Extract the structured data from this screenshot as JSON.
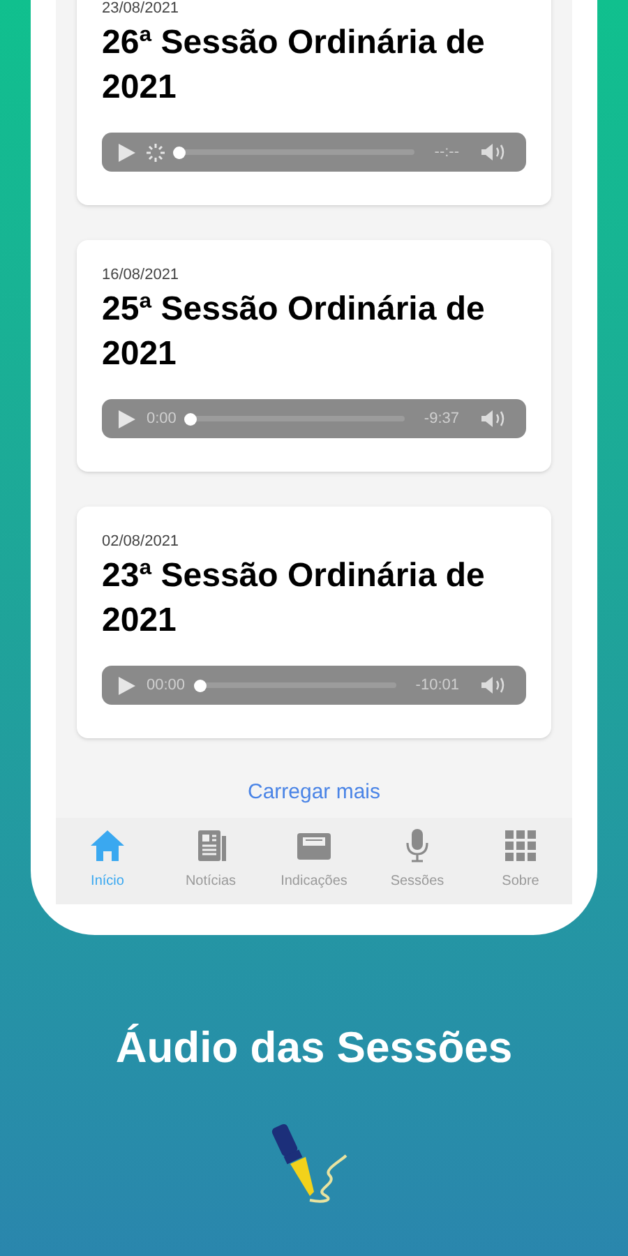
{
  "sessions": [
    {
      "date": "23/08/2021",
      "title": "26ª Sessão Ordinária de 2021",
      "player": {
        "loading": true,
        "remaining": "--:--",
        "level": 0
      }
    },
    {
      "date": "16/08/2021",
      "title": "25ª Sessão Ordinária de 2021",
      "player": {
        "loading": false,
        "elapsed": "0:00",
        "remaining": "-9:37",
        "level": 0
      }
    },
    {
      "date": "02/08/2021",
      "title": "23ª Sessão Ordinária de 2021",
      "player": {
        "loading": false,
        "elapsed": "00:00",
        "remaining": "-10:01",
        "level": 0
      }
    }
  ],
  "load_more": "Carregar mais",
  "tabs": [
    {
      "kind": "home",
      "label": "Início",
      "selected": true
    },
    {
      "kind": "news",
      "label": "Notícias",
      "selected": false
    },
    {
      "kind": "inbox",
      "label": "Indicações",
      "selected": false
    },
    {
      "kind": "mic",
      "label": "Sessões",
      "selected": false
    },
    {
      "kind": "grid",
      "label": "Sobre",
      "selected": false
    }
  ],
  "caption": "Áudio das Sessões"
}
